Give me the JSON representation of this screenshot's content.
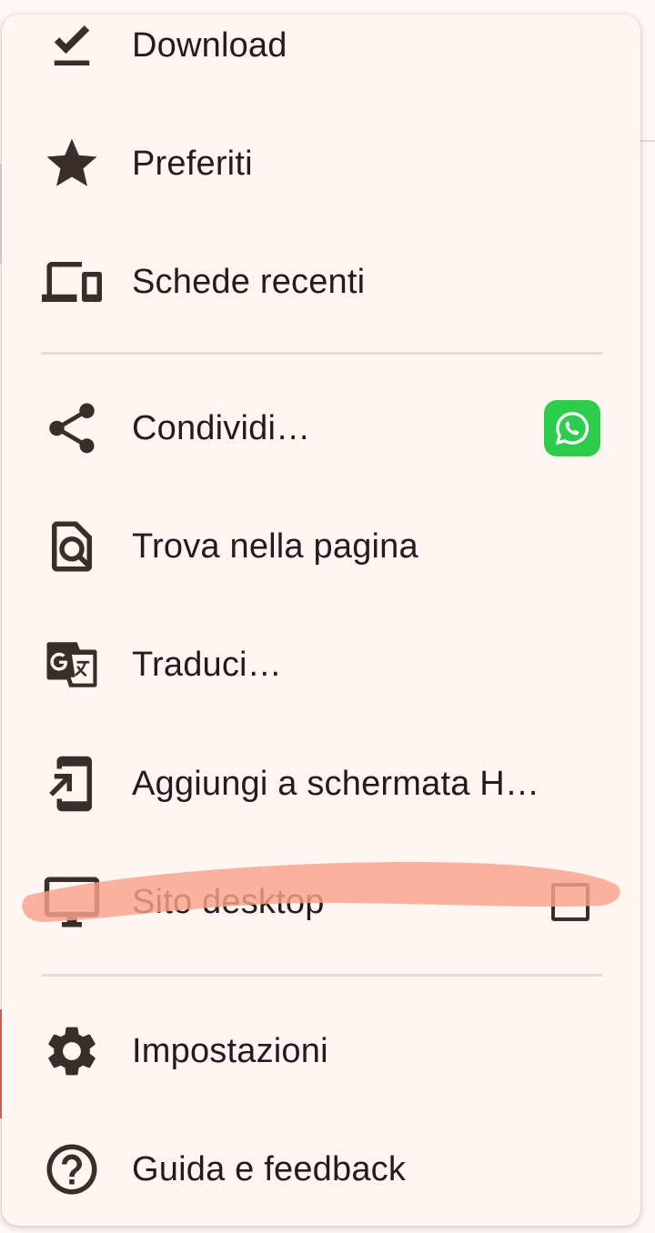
{
  "menu": {
    "items": [
      {
        "label": "Download",
        "icon": "download-done-icon"
      },
      {
        "label": "Preferiti",
        "icon": "star-icon"
      },
      {
        "label": "Schede recenti",
        "icon": "devices-icon"
      },
      {
        "label": "Condividi…",
        "icon": "share-icon"
      },
      {
        "label": "Trova nella pagina",
        "icon": "find-in-page-icon"
      },
      {
        "label": "Traduci…",
        "icon": "translate-icon"
      },
      {
        "label": "Aggiungi a schermata H…",
        "icon": "add-to-home-icon"
      },
      {
        "label": "Sito desktop",
        "icon": "desktop-icon"
      },
      {
        "label": "Impostazioni",
        "icon": "gear-icon"
      },
      {
        "label": "Guida e feedback",
        "icon": "help-icon"
      }
    ],
    "share_shortcut": "whatsapp-icon",
    "desktop_site_checked": false
  },
  "colors": {
    "menu_background": "#fff5f3",
    "text": "#241b1a",
    "whatsapp": "#2ccd4a",
    "highlight": "#f6a48a"
  }
}
